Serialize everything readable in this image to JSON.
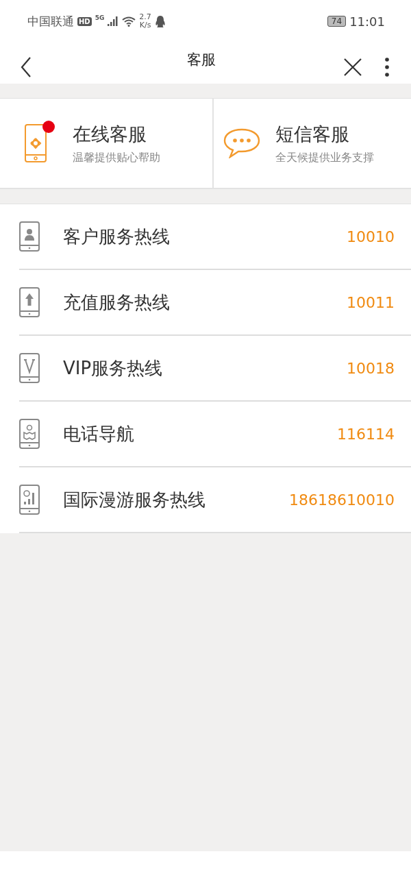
{
  "status_bar": {
    "carrier": "中国联通",
    "hd": "HD",
    "network": "5G",
    "speed_value": "2.7",
    "speed_unit": "K/s",
    "battery": "74",
    "time": "11:01"
  },
  "nav": {
    "title": "客服"
  },
  "service_cards": [
    {
      "kind": "phone",
      "title": "在线客服",
      "subtitle": "温馨提供贴心帮助",
      "unread": true
    },
    {
      "kind": "chat",
      "title": "短信客服",
      "subtitle": "全天候提供业务支撑",
      "unread": false
    }
  ],
  "hotlines": [
    {
      "kind": "person",
      "name": "客户服务热线",
      "number": "10010"
    },
    {
      "kind": "upload",
      "name": "充值服务热线",
      "number": "10011"
    },
    {
      "kind": "vip",
      "name": "VIP服务热线",
      "number": "10018"
    },
    {
      "kind": "map",
      "name": "电话导航",
      "number": "116114"
    },
    {
      "kind": "globe",
      "name": "国际漫游服务热线",
      "number": "18618610010"
    }
  ]
}
